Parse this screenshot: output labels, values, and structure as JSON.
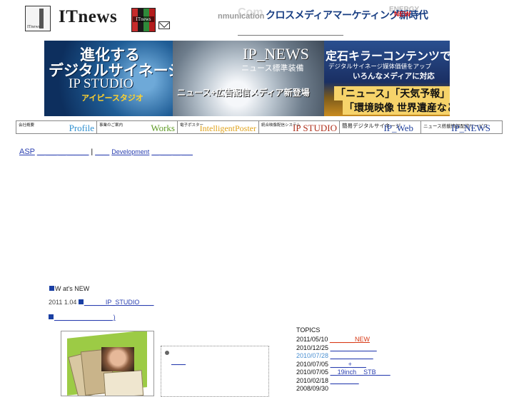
{
  "header": {
    "logo_label": "ITnews",
    "logo_text": "ITnews",
    "mosaic_caption": "ITnews",
    "ghost_left": "nmunication",
    "ghost_mid": "Com",
    "ghost_right": "ENERGY",
    "tagline": "クロスメディアマーケティング新時代",
    "tagline_badge": "NEW"
  },
  "banner": {
    "panel1": {
      "line1": "進化する",
      "line2": "デジタルサイネージ",
      "line3": "IP STUDIO",
      "line4": "アイピースタジオ"
    },
    "panel2": {
      "line1": "IP_NEWS",
      "line2": "ニュース標準装備",
      "line3": "ニュース+広告配信メディア新登場"
    },
    "panel3": {
      "line1": "定石キラーコンテンツで",
      "line2": "デジタルサイネージ媒体価値をアップ",
      "line3": "いろんなメディアに対応",
      "line4": "「ニュース」「天気予報」",
      "line5": "「環境映像 世界遺産など」"
    }
  },
  "nav": [
    {
      "small": "会社概要",
      "large": "Profile",
      "color": "#2e8fd0"
    },
    {
      "small": "事業のご案内",
      "large": "Works",
      "color": "#5c9a22"
    },
    {
      "small": "電子ポスター",
      "large": "IntelligentPoster",
      "color": "#e0a21a"
    },
    {
      "small": "統合映像配信システム",
      "large": "IP STUDIO",
      "color": "#b0301c"
    },
    {
      "small": "簡易デジタルサイネージ",
      "large": "IP_Web",
      "color": "#1f3f9c"
    },
    {
      "small": "ニュース搭載情報配信サービス",
      "large": "IP_NEWS",
      "color": "#1f3f9c"
    }
  ],
  "links": {
    "asp": "ASP",
    "asp_tail": "__ ___ __ ______",
    "separator": "|",
    "dev_lead": "____",
    "development": "Development",
    "dev_tail": "__ ___ __ ___"
  },
  "news": {
    "heading": "W at's NEW",
    "item1_date": "2011 1.04",
    "item1_link": "______IP_STUDIO____",
    "item2_link": "________________ )"
  },
  "dotbox": {
    "link": "____"
  },
  "topics": {
    "heading": "TOPICS",
    "rows": [
      {
        "date": "2011/05/10",
        "text": "_______NEW",
        "is_new": true
      },
      {
        "date": "2010/12/25",
        "text": "_____________"
      },
      {
        "date": "2010/07/28",
        "text": "____________"
      },
      {
        "date": "2010/07/05",
        "text": "_____+____"
      },
      {
        "date": "2010/07/05",
        "text": "__19inch__STB____"
      },
      {
        "date": "2010/02/18",
        "text": "________"
      },
      {
        "date": "2008/09/30",
        "text": ""
      }
    ]
  },
  "colors": {
    "link": "#2a3fb0",
    "tagline": "#173d82",
    "new": "#e02020",
    "bullet": "#1a3fa3"
  }
}
